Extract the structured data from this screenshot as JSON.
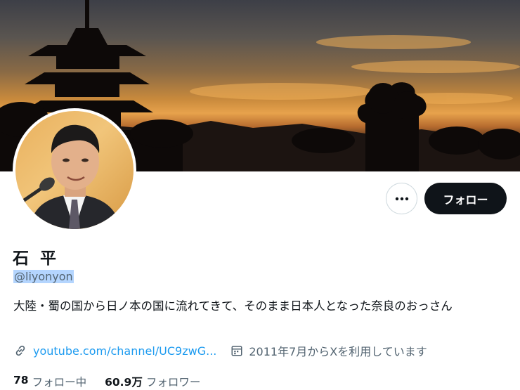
{
  "profile": {
    "name": "石 平",
    "handle": "@liyonyon",
    "bio": "大陸・蜀の国から日ノ本の国に流れてきて、そのまま日本人となった奈良のおっさん",
    "link": "youtube.com/channel/UC9zwG...",
    "joined": "2011年7月からXを利用しています"
  },
  "actions": {
    "more_icon": "more-horizontal-icon",
    "follow_label": "フォロー"
  },
  "stats": {
    "following_count": "78",
    "following_label": "フォロー中",
    "followers_count": "60.9万",
    "followers_label": "フォロワー"
  },
  "icons": {
    "link": "link-icon",
    "calendar": "calendar-icon"
  },
  "colors": {
    "accent": "#1d9bf0",
    "text": "#0f1419",
    "secondary": "#536471",
    "button_dark": "#0f1419",
    "selection": "#b4d5fe"
  }
}
